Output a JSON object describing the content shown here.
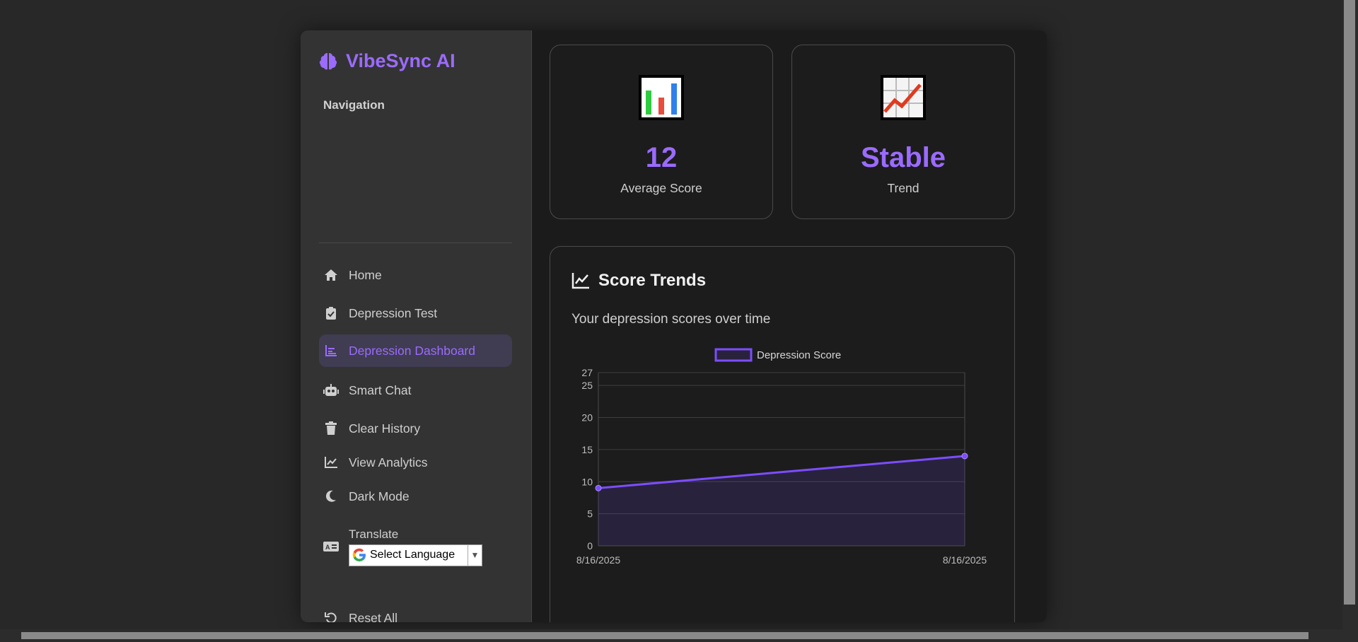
{
  "brand": {
    "name": "VibeSync AI",
    "icon": "brain-icon",
    "color": "#9b6bff"
  },
  "sidebar": {
    "heading": "Navigation",
    "items": [
      {
        "label": "Home",
        "icon": "home-icon"
      },
      {
        "label": "Depression Test",
        "icon": "clipboard-check-icon"
      },
      {
        "label": "Depression Dashboard",
        "icon": "chart-bars-icon",
        "active": true
      },
      {
        "label": "Smart Chat",
        "icon": "robot-icon"
      },
      {
        "label": "Clear History",
        "icon": "trash-icon"
      },
      {
        "label": "View Analytics",
        "icon": "line-chart-icon"
      },
      {
        "label": "Dark Mode",
        "icon": "moon-icon"
      },
      {
        "label": "Translate",
        "icon": "translate-icon"
      },
      {
        "label": "Reset All",
        "icon": "undo-icon"
      }
    ],
    "translate_select": "Select Language"
  },
  "stats": [
    {
      "value": "12",
      "label": "Average Score",
      "icon": "bar-chart-emoji"
    },
    {
      "value": "Stable",
      "label": "Trend",
      "icon": "trend-up-emoji"
    }
  ],
  "chart_card": {
    "title": "Score Trends",
    "subtitle": "Your depression scores over time"
  },
  "chart_data": {
    "type": "line",
    "x": [
      "8/16/2025",
      "8/16/2025"
    ],
    "series": [
      {
        "name": "Depression Score",
        "values": [
          9,
          14
        ],
        "color": "#7c4dff"
      }
    ],
    "ylim": [
      0,
      27
    ],
    "yticks": [
      0,
      5,
      10,
      15,
      20,
      25,
      27
    ],
    "grid": true,
    "legend": "top-center",
    "fill": true
  }
}
